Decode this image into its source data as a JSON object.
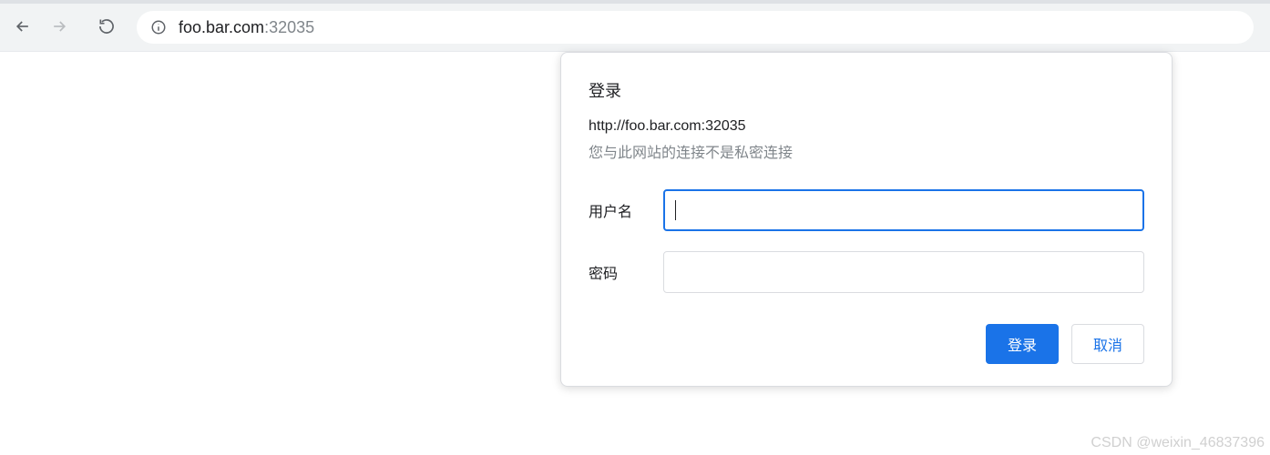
{
  "toolbar": {
    "url_host": "foo.bar.com",
    "url_port": ":32035"
  },
  "dialog": {
    "title": "登录",
    "origin": "http://foo.bar.com:32035",
    "warning": "您与此网站的连接不是私密连接",
    "username_label": "用户名",
    "username_value": "",
    "password_label": "密码",
    "password_value": "",
    "submit_label": "登录",
    "cancel_label": "取消"
  },
  "watermark": "CSDN @weixin_46837396"
}
